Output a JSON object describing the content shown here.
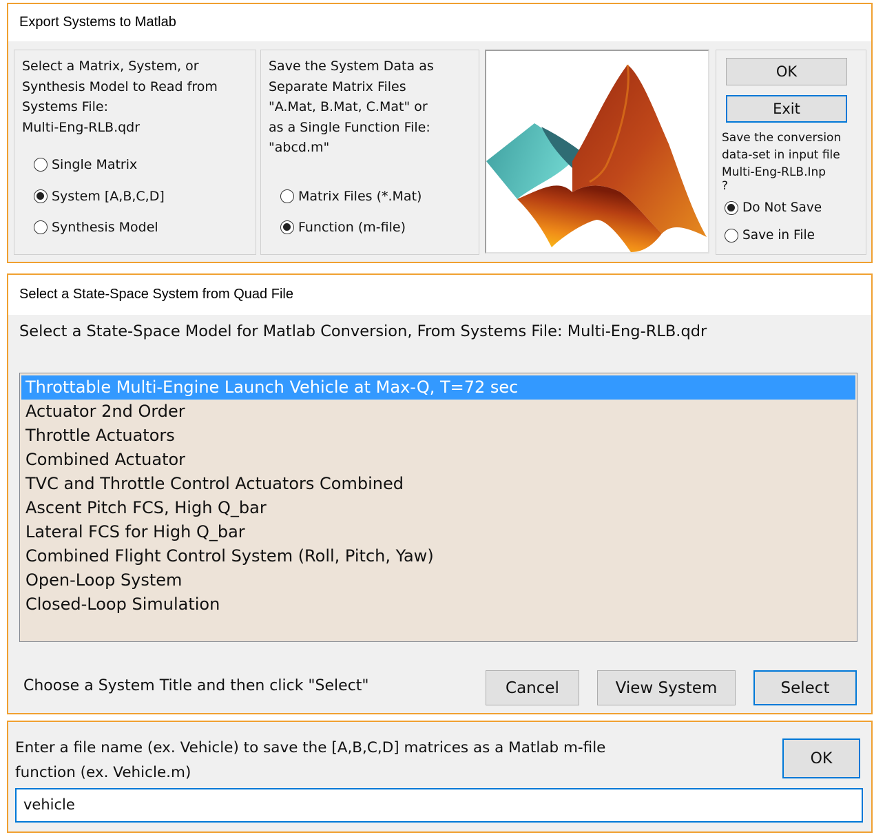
{
  "export_dialog": {
    "title": "Export Systems to Matlab",
    "source_panel": {
      "line1": "Select a Matrix, System, or",
      "line2": "Synthesis Model to Read from",
      "line3": "Systems File:",
      "line4": "Multi-Eng-RLB.qdr",
      "options": [
        {
          "label": "Single Matrix",
          "selected": false
        },
        {
          "label": "System [A,B,C,D]",
          "selected": true
        },
        {
          "label": "Synthesis Model",
          "selected": false
        }
      ]
    },
    "format_panel": {
      "line1": "Save the System Data as",
      "line2": "Separate Matrix Files",
      "line3": "\"A.Mat, B.Mat, C.Mat\" or",
      "line4": "as a Single Function File:",
      "line5": "\"abcd.m\"",
      "options": [
        {
          "label": "Matrix Files (*.Mat)",
          "selected": false
        },
        {
          "label": "Function (m-file)",
          "selected": true
        }
      ]
    },
    "logo_icon": "matlab-membrane-logo",
    "ok_label": "OK",
    "exit_label": "Exit",
    "save_panel": {
      "line1": "Save the conversion",
      "line2": "data-set in input file",
      "line3": "Multi-Eng-RLB.Inp",
      "line4": "?",
      "options": [
        {
          "label": "Do Not Save",
          "selected": true
        },
        {
          "label": "Save in File",
          "selected": false
        }
      ]
    }
  },
  "select_dialog": {
    "title": "Select a State-Space System from Quad File",
    "header": "Select a State-Space Model for  Matlab Conversion,  From Systems File: Multi-Eng-RLB.qdr",
    "items": [
      "Throttable Multi-Engine Launch Vehicle at Max-Q, T=72 sec",
      "Actuator 2nd Order",
      "Throttle Actuators",
      "Combined Actuator",
      "TVC and Throttle Control Actuators Combined",
      "Ascent Pitch FCS, High Q_bar",
      "Lateral FCS for High Q_bar",
      "Combined Flight Control System (Roll, Pitch, Yaw)",
      "Open-Loop System",
      "Closed-Loop Simulation"
    ],
    "selected_index": 0,
    "instruction": "Choose a System Title and then click \"Select\"",
    "cancel_label": "Cancel",
    "view_label": "View System",
    "select_label": "Select"
  },
  "filename_dialog": {
    "prompt_line1": "Enter a file name (ex. Vehicle) to save the [A,B,C,D] matrices as a Matlab m-file",
    "prompt_line2": "function (ex. Vehicle.m)",
    "ok_label": "OK",
    "input_value": "vehicle"
  },
  "colors": {
    "dialog_border": "#f0a030",
    "selection": "#3399ff",
    "list_background": "#ede3d8",
    "default_button_border": "#0078d7"
  }
}
